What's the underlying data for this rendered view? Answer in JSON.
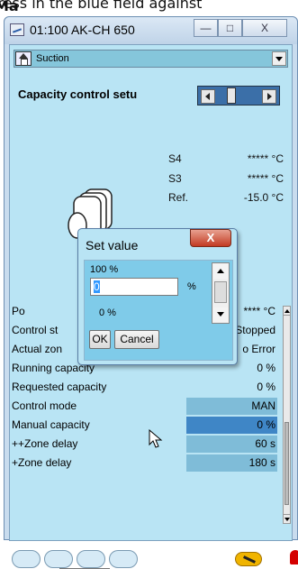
{
  "instruction_strip": {
    "prefix": "Press in the blue field against ",
    "bold": "Ma"
  },
  "window": {
    "title": "01:100 AK-CH 650",
    "minimize": "—",
    "maximize": "□",
    "close": "X"
  },
  "combo": {
    "selected": "Suction"
  },
  "section": {
    "title": "Capacity control setu"
  },
  "sensors": [
    {
      "label": "S4",
      "value": "***** °C"
    },
    {
      "label": "S3",
      "value": "***** °C"
    },
    {
      "label": "Ref.",
      "value": "-15.0 °C"
    }
  ],
  "rows": [
    {
      "label": "Po",
      "value": "**** °C"
    },
    {
      "label": "Control st",
      "value": "Stopped"
    },
    {
      "label": "Actual zon",
      "value": "o Error"
    },
    {
      "label": "Running capacity",
      "value": "0 %"
    },
    {
      "label": "Requested capacity",
      "value": "0 %"
    },
    {
      "label": "Control mode",
      "value": "MAN"
    },
    {
      "label": "Manual capacity",
      "value": "0 %"
    },
    {
      "label": "++Zone delay",
      "value": "60 s"
    },
    {
      "label": "+Zone delay",
      "value": "180 s"
    }
  ],
  "dialog": {
    "title": "Set value",
    "close": "X",
    "max_label": "100 %",
    "input_value": "0",
    "unit": "%",
    "min_label": "0 %",
    "ok": "OK",
    "cancel": "Cancel"
  },
  "toolbar": {
    "icons": [
      "compressor-status-icon",
      "fan-icon",
      "condenser-icon",
      "system-icon",
      "wrench-icon",
      "alarm-icon"
    ]
  },
  "colors": {
    "field_blue": "#7fbcd8",
    "active_field": "#3f86c6",
    "panel_bg": "#b9e4f4",
    "alarm_red": "#d40000"
  }
}
